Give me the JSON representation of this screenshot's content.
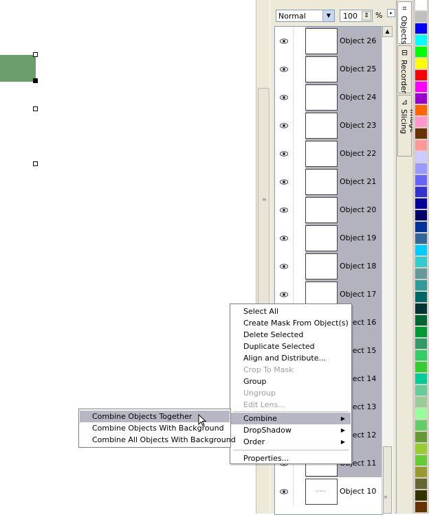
{
  "toolbar": {
    "blend_mode": "Normal",
    "opacity": "100",
    "percent_sign": "%"
  },
  "objects": [
    {
      "name": "Object 26",
      "selected": true
    },
    {
      "name": "Object 25",
      "selected": true
    },
    {
      "name": "Object 24",
      "selected": true
    },
    {
      "name": "Object 23",
      "selected": true
    },
    {
      "name": "Object 22",
      "selected": true
    },
    {
      "name": "Object 21",
      "selected": true
    },
    {
      "name": "Object 20",
      "selected": true
    },
    {
      "name": "Object 19",
      "selected": true
    },
    {
      "name": "Object 18",
      "selected": true
    },
    {
      "name": "Object 17",
      "selected": true
    },
    {
      "name": "Object 16",
      "selected": true
    },
    {
      "name": "Object 15",
      "selected": true
    },
    {
      "name": "Object 14",
      "selected": true
    },
    {
      "name": "Object 13",
      "selected": true
    },
    {
      "name": "Object 12",
      "selected": true
    },
    {
      "name": "Object 11",
      "selected": true
    },
    {
      "name": "Object 10",
      "selected": false
    }
  ],
  "tabs": [
    {
      "label": "Objects",
      "icon": "objects-icon",
      "active": true
    },
    {
      "label": "Recorder",
      "icon": "recorder-icon",
      "active": false
    },
    {
      "label": "Image Slicing",
      "icon": "image-slicing-icon",
      "active": false
    }
  ],
  "palette": [
    "#ffffff",
    "#c0c0c0",
    "#0000ff",
    "#00ffff",
    "#00ff00",
    "#ffff00",
    "#ff0000",
    "#ff00ff",
    "#9900cc",
    "#ff6600",
    "#ff99cc",
    "#663300",
    "#ff9999",
    "#ccccff",
    "#9999ff",
    "#6666ff",
    "#3333cc",
    "#000099",
    "#000066",
    "#003399",
    "#336699",
    "#00ccff",
    "#33cccc",
    "#669999",
    "#339999",
    "#006666",
    "#003333",
    "#006633",
    "#009933",
    "#339966",
    "#33cc66",
    "#33cc33",
    "#00cc99",
    "#66cc99",
    "#99cc99",
    "#99ff99",
    "#66cc66",
    "#669933",
    "#99cc33",
    "#66cc33",
    "#999933",
    "#666633",
    "#333300",
    "#663300"
  ],
  "context_menu": {
    "items": [
      {
        "label": "Select All",
        "disabled": false
      },
      {
        "label": "Create Mask From Object(s)",
        "disabled": false
      },
      {
        "label": "Delete Selected",
        "disabled": false
      },
      {
        "label": "Duplicate Selected",
        "disabled": false
      },
      {
        "label": "Align and Distribute...",
        "disabled": false
      },
      {
        "label": "Crop To Mask",
        "disabled": true
      },
      {
        "label": "Group",
        "disabled": false
      },
      {
        "label": "Ungroup",
        "disabled": true
      },
      {
        "label": "Edit Lens...",
        "disabled": true
      },
      {
        "label": "Combine",
        "disabled": false,
        "submenu": true,
        "highlighted": true
      },
      {
        "label": "DropShadow",
        "disabled": false,
        "submenu": true
      },
      {
        "label": "Order",
        "disabled": false,
        "submenu": true
      },
      {
        "label": "Properties...",
        "disabled": false
      }
    ]
  },
  "combine_submenu": {
    "items": [
      {
        "label": "Combine Objects Together",
        "highlighted": true
      },
      {
        "label": "Combine Objects With Background",
        "highlighted": false
      },
      {
        "label": "Combine All Objects With Background",
        "highlighted": false
      }
    ]
  },
  "icons": {
    "eye": "eye-icon",
    "dropdown": "chevron-down-icon",
    "scroll_up": "chevron-up-icon",
    "submenu_arrow": "chevron-right-icon"
  }
}
